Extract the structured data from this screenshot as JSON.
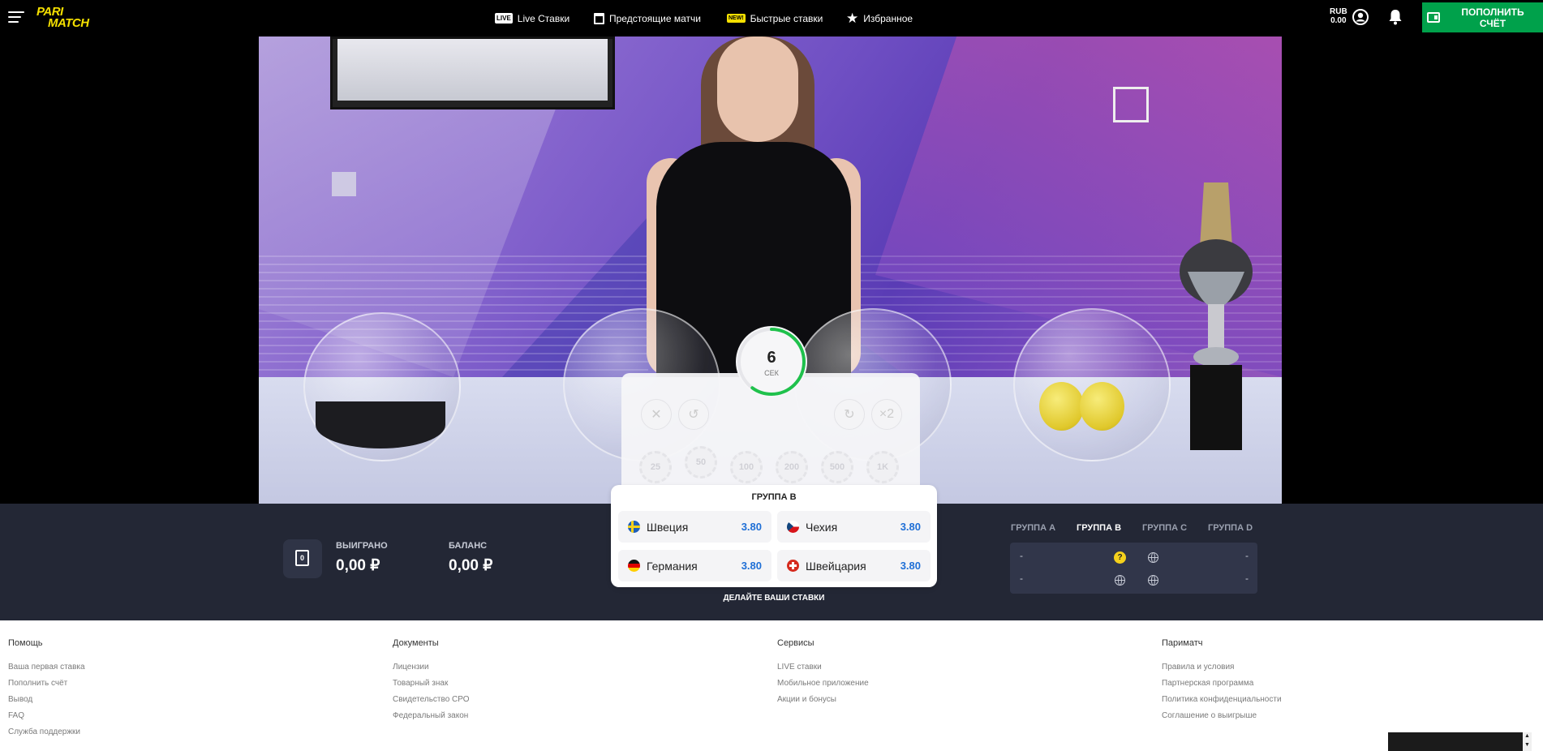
{
  "header": {
    "nav": [
      {
        "label": "Live Ставки",
        "icon": "live-badge-icon",
        "badge": "LIVE"
      },
      {
        "label": "Предстоящие матчи",
        "icon": "calendar-icon"
      },
      {
        "label": "Быстрые ставки",
        "icon": "new-badge-icon",
        "badge": "NEW!"
      },
      {
        "label": "Избранное",
        "icon": "star-icon"
      }
    ],
    "currency": "RUB",
    "balance": "0.00",
    "deposit_label": "ПОПОЛНИТЬ СЧЁТ",
    "colors": {
      "brand_yellow": "#f5e000",
      "deposit_green": "#00a14b"
    }
  },
  "logo": {
    "line1": "PARI",
    "line2": "MATCH"
  },
  "timer": {
    "value": "6",
    "unit": "СЕК",
    "progress": 0.6
  },
  "bet_panel": {
    "controls": [
      "✕",
      "↺",
      "↻",
      "×2"
    ],
    "chips": [
      "25",
      "50",
      "100",
      "200",
      "500",
      "1K"
    ]
  },
  "group_card": {
    "title": "ГРУППА B",
    "options": [
      {
        "team": "Швеция",
        "odd": "3.80",
        "flag": "sweden-flag-icon"
      },
      {
        "team": "Чехия",
        "odd": "3.80",
        "flag": "czech-flag-icon"
      },
      {
        "team": "Германия",
        "odd": "3.80",
        "flag": "germany-flag-icon"
      },
      {
        "team": "Швейцария",
        "odd": "3.80",
        "flag": "switzerland-flag-icon"
      }
    ],
    "prompt": "ДЕЛАЙТЕ ВАШИ СТАВКИ"
  },
  "stats": {
    "won_label": "ВЫИГРАНО",
    "won_value": "0,00 ₽",
    "balance_label": "БАЛАНС",
    "balance_value": "0,00 ₽",
    "icon_digit": "0"
  },
  "groups": {
    "tabs": [
      "ГРУППА A",
      "ГРУППА B",
      "ГРУППА C",
      "ГРУППА D"
    ],
    "active": 1,
    "rows": [
      {
        "left": "-",
        "right": "-"
      },
      {
        "left": "-",
        "right": "-"
      }
    ],
    "question_mark": "?"
  },
  "footer": {
    "columns": [
      {
        "title": "Помощь",
        "links": [
          "Ваша первая ставка",
          "Пополнить счёт",
          "Вывод",
          "FAQ",
          "Служба поддержки"
        ]
      },
      {
        "title": "Документы",
        "links": [
          "Лицензии",
          "Товарный знак",
          "Свидетельство СРО",
          "Федеральный закон"
        ]
      },
      {
        "title": "Сервисы",
        "links": [
          "LIVE ставки",
          "Мобильное приложение",
          "Акции и бонусы"
        ]
      },
      {
        "title": "Париматч",
        "links": [
          "Правила и условия",
          "Партнерская программа",
          "Политика конфиденциальности",
          "Соглашение о выигрыше"
        ]
      }
    ]
  }
}
